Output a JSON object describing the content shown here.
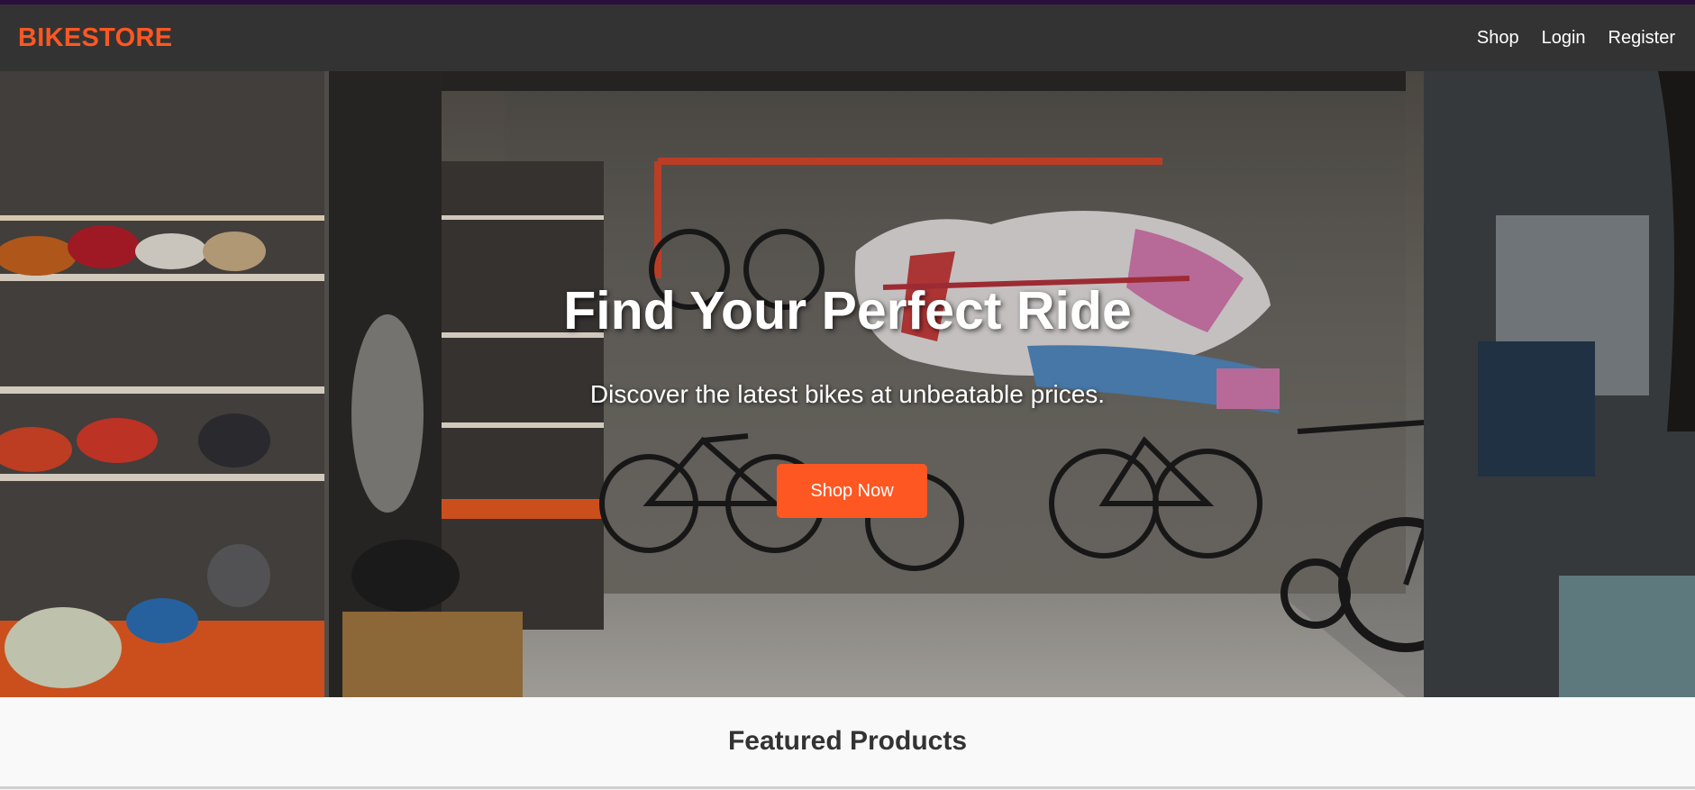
{
  "header": {
    "brand": "BIKESTORE",
    "nav": [
      "Shop",
      "Login",
      "Register"
    ]
  },
  "hero": {
    "title": "Find Your Perfect Ride",
    "subtitle": "Discover the latest bikes at unbeatable prices.",
    "cta_label": "Shop Now",
    "background_image": "bike-shop-interior-photo"
  },
  "featured": {
    "title": "Featured Products"
  },
  "colors": {
    "accent": "#ff5722",
    "navbar": "#333333",
    "top_strip": "#2a0f3a",
    "page_bg": "#f9f9f9"
  }
}
